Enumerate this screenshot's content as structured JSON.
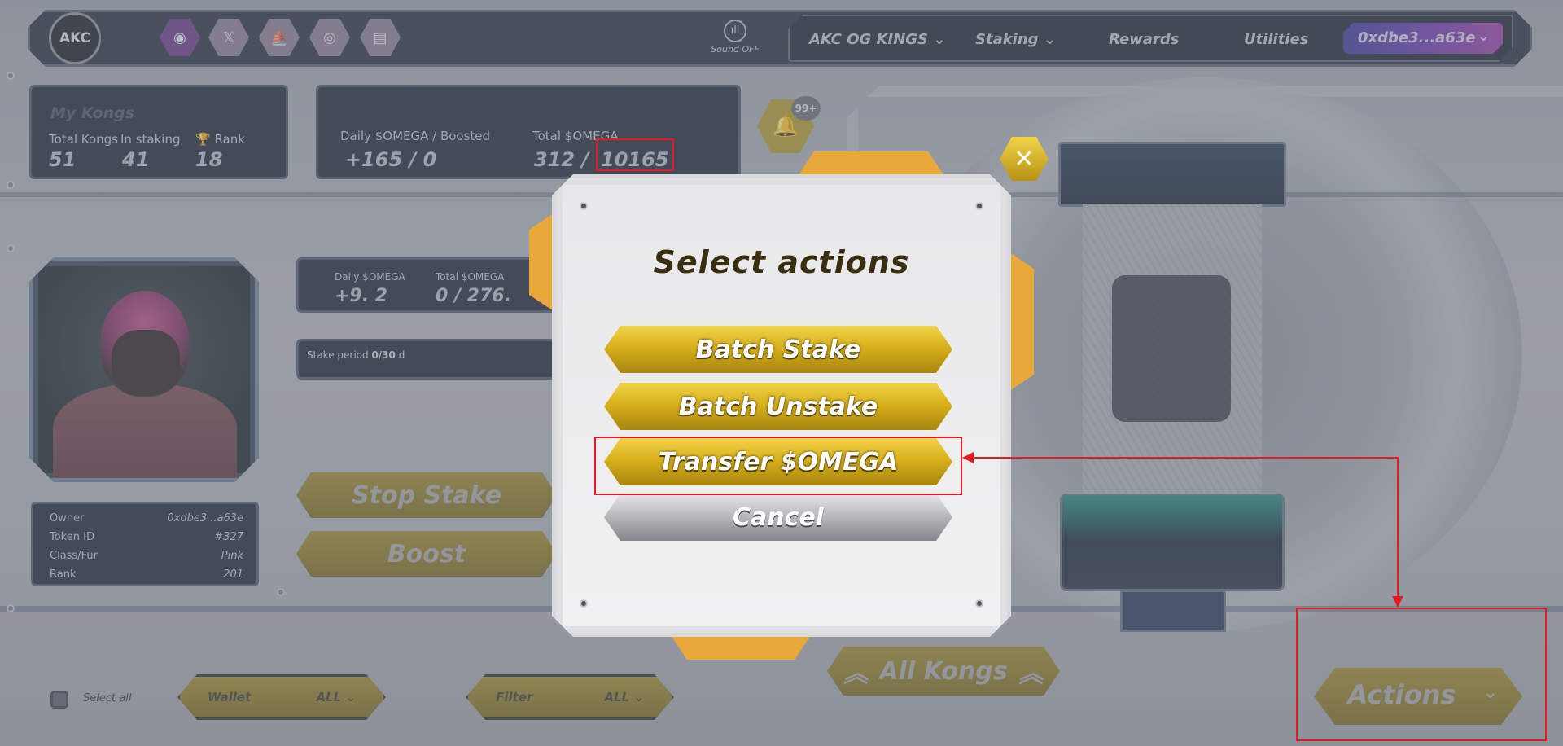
{
  "topbar": {
    "logo_text": "AKC",
    "social_icons": [
      "discord-icon",
      "x-icon",
      "opensea-icon",
      "instagram-icon",
      "gitbook-icon"
    ],
    "sound_label": "Sound OFF",
    "nav": {
      "akc_og_kings": "AKC OG KINGS",
      "staking": "Staking",
      "rewards": "Rewards",
      "utilities": "Utilities"
    },
    "wallet_address": "0xdbe3...a63e"
  },
  "my_kongs": {
    "title": "My Kongs",
    "total_kongs_label": "Total Kongs",
    "total_kongs_value": "51",
    "in_staking_label": "In staking",
    "in_staking_value": "41",
    "rank_label": "Rank",
    "rank_value": "18"
  },
  "omega_stats": {
    "daily_label": "Daily $OMEGA / Boosted",
    "daily_value": "+165 / 0",
    "total_label": "Total $OMEGA",
    "total_value_a": "312 /",
    "total_value_b": "10165"
  },
  "notifications": {
    "badge": "99+"
  },
  "kong_detail": {
    "daily_label": "Daily $OMEGA",
    "daily_value": "+9. 2",
    "total_label": "Total $OMEGA",
    "total_value": "0 / 276.",
    "stake_period_label": "Stake period",
    "stake_period_value": "0/30",
    "stake_period_unit": "d",
    "stop_stake_label": "Stop Stake",
    "boost_label": "Boost"
  },
  "kong_info": {
    "owner_label": "Owner",
    "owner_value": "0xdbe3...a63e",
    "token_label": "Token ID",
    "token_value": "#327",
    "class_label": "Class/Fur",
    "class_value": "Pink",
    "rank_label": "Rank",
    "rank_value": "201"
  },
  "bottom_bar": {
    "select_all_label": "Select all",
    "wallet_label": "Wallet",
    "wallet_value": "ALL",
    "filter_label": "Filter",
    "filter_value": "ALL",
    "all_kongs_label": "All Kongs",
    "actions_label": "Actions"
  },
  "modal": {
    "title": "Select actions",
    "batch_stake": "Batch Stake",
    "batch_unstake": "Batch Unstake",
    "transfer_omega": "Transfer $OMEGA",
    "cancel": "Cancel",
    "close": "✕"
  },
  "colors": {
    "highlight": "#e51b23",
    "gold": "#d8b11c",
    "wallet_pill": "#6a3bb0"
  }
}
